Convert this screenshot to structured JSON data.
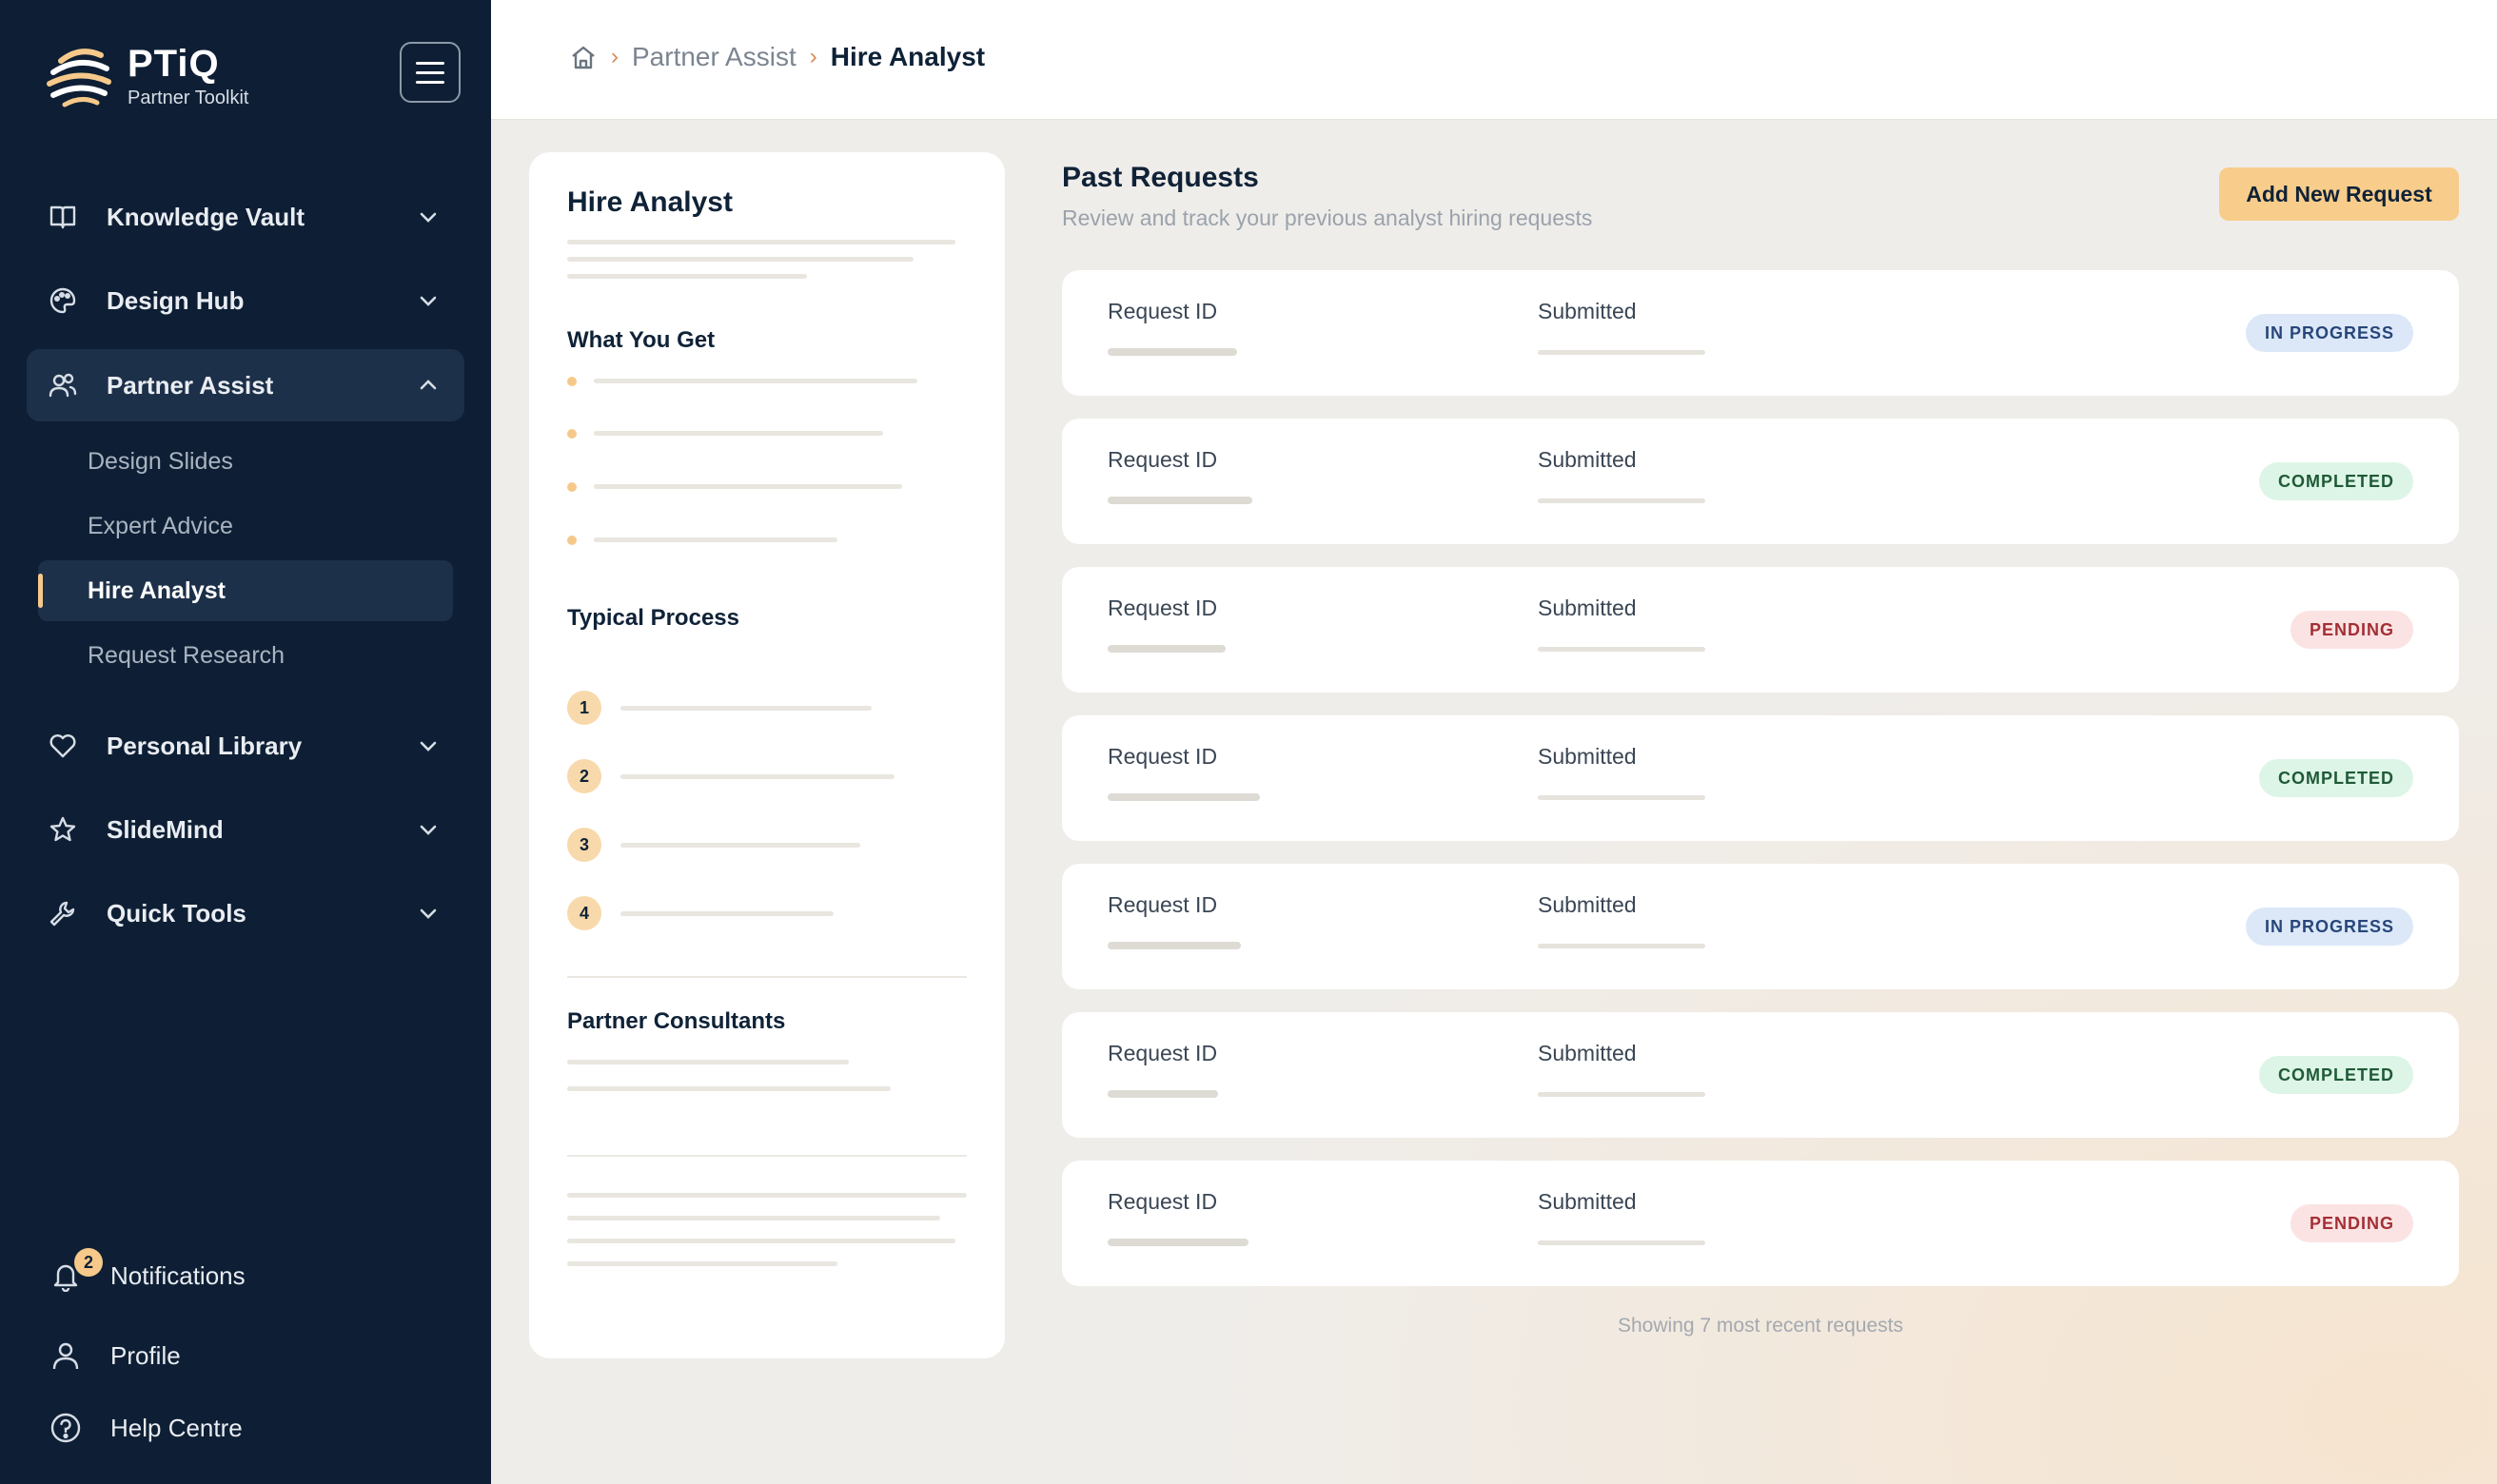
{
  "brand": {
    "name": "PTiQ",
    "subtitle": "Partner Toolkit"
  },
  "colors": {
    "sidebar_bg": "#0e1f35",
    "accent": "#f6c98a",
    "in_progress": "#dce8f8",
    "completed": "#ddf5e6",
    "pending": "#fbe3e3"
  },
  "sidebar": {
    "items": [
      {
        "label": "Knowledge Vault",
        "icon": "book-icon",
        "expanded": false
      },
      {
        "label": "Design Hub",
        "icon": "palette-icon",
        "expanded": false
      },
      {
        "label": "Partner Assist",
        "icon": "users-icon",
        "expanded": true,
        "children": [
          "Design Slides",
          "Expert Advice",
          "Hire Analyst",
          "Request Research"
        ],
        "active_child": "Hire Analyst"
      },
      {
        "label": "Personal Library",
        "icon": "heart-icon",
        "expanded": false
      },
      {
        "label": "SlideMind",
        "icon": "star-icon",
        "expanded": false
      },
      {
        "label": "Quick Tools",
        "icon": "wrench-icon",
        "expanded": false
      }
    ],
    "footer": {
      "notifications": {
        "label": "Notifications",
        "count": "2"
      },
      "profile": {
        "label": "Profile"
      },
      "help": {
        "label": "Help Centre"
      }
    }
  },
  "breadcrumb": {
    "parent": "Partner Assist",
    "current": "Hire Analyst"
  },
  "info_panel": {
    "title": "Hire Analyst",
    "what_you_get": "What You Get",
    "typical_process": "Typical Process",
    "steps": [
      "1",
      "2",
      "3",
      "4"
    ],
    "partner_consultants": "Partner Consultants"
  },
  "requests": {
    "title": "Past Requests",
    "subtitle": "Review and track your previous analyst hiring requests",
    "add_button": "Add New Request",
    "id_label": "Request ID",
    "submitted_label": "Submitted",
    "rows": [
      {
        "status": "IN PROGRESS",
        "kind": "progress"
      },
      {
        "status": "COMPLETED",
        "kind": "completed"
      },
      {
        "status": "PENDING",
        "kind": "pending"
      },
      {
        "status": "COMPLETED",
        "kind": "completed"
      },
      {
        "status": "IN PROGRESS",
        "kind": "progress"
      },
      {
        "status": "COMPLETED",
        "kind": "completed"
      },
      {
        "status": "PENDING",
        "kind": "pending"
      }
    ],
    "footer": "Showing 7 most recent requests"
  }
}
